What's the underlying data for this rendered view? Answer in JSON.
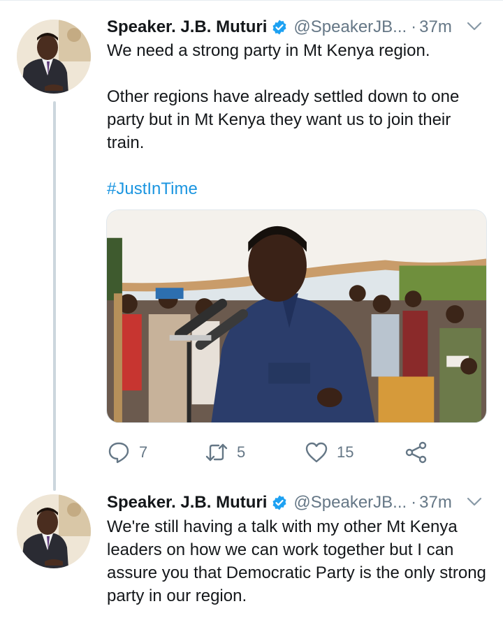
{
  "tweets": [
    {
      "author_name": "Speaker. J.B. Muturi",
      "handle": "@SpeakerJB...",
      "separator": "·",
      "time": "37m",
      "text_lines": [
        "We need a strong party in Mt Kenya region.",
        "Other regions have already settled down to one party but in Mt Kenya they want us to join their train."
      ],
      "hashtag": "#JustInTime",
      "replies": "7",
      "retweets": "5",
      "likes": "15"
    },
    {
      "author_name": "Speaker. J.B. Muturi",
      "handle": "@SpeakerJB...",
      "separator": "·",
      "time": "37m",
      "text": "We're still having a talk with my other Mt Kenya leaders on how we can work together but I can assure you that Democratic Party is the only strong party in our region."
    }
  ],
  "icons": {
    "verified": "verified-badge-icon",
    "menu": "chevron-down-icon",
    "reply": "reply-icon",
    "retweet": "retweet-icon",
    "like": "heart-icon",
    "share": "share-icon"
  },
  "colors": {
    "text": "#14171a",
    "muted": "#657786",
    "link": "#1b95e0",
    "verified": "#1da1f2",
    "thread_line": "#ccd6dd"
  }
}
